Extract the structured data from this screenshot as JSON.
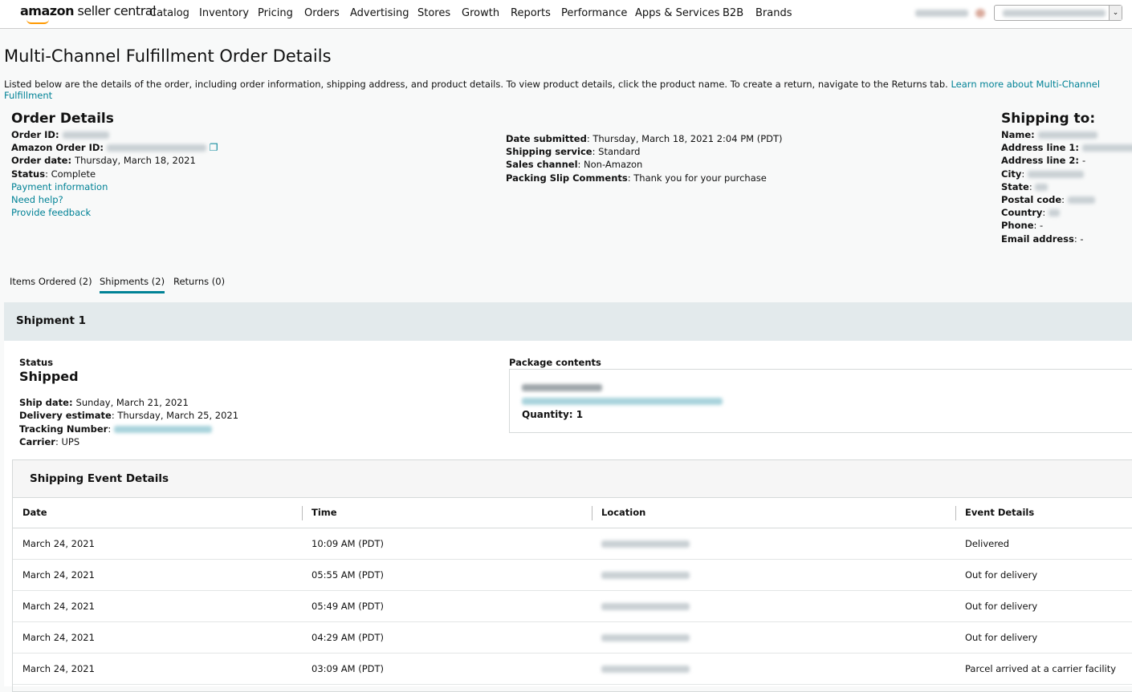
{
  "nav": {
    "logo_bold": "amazon",
    "logo_rest": " seller central",
    "items": [
      "Catalog",
      "Inventory",
      "Pricing",
      "Orders",
      "Advertising",
      "Stores",
      "Growth",
      "Reports",
      "Performance",
      "Apps & Services",
      "B2B",
      "Brands"
    ]
  },
  "page": {
    "title": "Multi-Channel Fulfillment Order Details",
    "description": "Listed below are the details of the order, including order information, shipping address, and product details. To view product details, click the product name. To create a return, navigate to the Returns tab. ",
    "learn_more": "Learn more about Multi-Channel Fulfillment"
  },
  "order": {
    "heading": "Order Details",
    "order_id_label": "Order ID",
    "amazon_order_id_label": "Amazon Order ID",
    "order_date_label": "Order date",
    "order_date": "Thursday, March 18, 2021",
    "status_label": "Status",
    "status": "Complete",
    "links": [
      "Payment information",
      "Need help?",
      "Provide feedback"
    ]
  },
  "middle": {
    "date_submitted_label": "Date submitted",
    "date_submitted": "Thursday, March 18, 2021 2:04 PM (PDT)",
    "shipping_service_label": "Shipping service",
    "shipping_service": "Standard",
    "sales_channel_label": "Sales channel",
    "sales_channel": "Non-Amazon",
    "packing_slip_label": "Packing Slip Comments",
    "packing_slip": "Thank you for your purchase"
  },
  "shipping_to": {
    "heading": "Shipping to:",
    "name_label": "Name",
    "address1_label": "Address line 1",
    "address2_label": "Address line 2",
    "address2": "-",
    "city_label": "City",
    "state_label": "State",
    "postal_label": "Postal code",
    "country_label": "Country",
    "phone_label": "Phone",
    "phone": "-",
    "email_label": "Email address",
    "email": "-"
  },
  "tabs": [
    "Items Ordered (2)",
    "Shipments (2)",
    "Returns (0)"
  ],
  "shipment": {
    "title": "Shipment 1",
    "status_label": "Status",
    "status": "Shipped",
    "ship_date_label": "Ship date",
    "ship_date": "Sunday, March 21, 2021",
    "delivery_label": "Delivery estimate",
    "delivery": "Thursday, March 25, 2021",
    "tracking_label": "Tracking Number",
    "carrier_label": "Carrier",
    "carrier": "UPS",
    "package_label": "Package contents",
    "quantity_label": "Quantity",
    "quantity": "1"
  },
  "events": {
    "title": "Shipping Event Details",
    "columns": [
      "Date",
      "Time",
      "Location",
      "Event Details"
    ],
    "rows": [
      {
        "date": "March 24, 2021",
        "time": "10:09 AM (PDT)",
        "event": "Delivered"
      },
      {
        "date": "March 24, 2021",
        "time": "05:55 AM (PDT)",
        "event": "Out for delivery"
      },
      {
        "date": "March 24, 2021",
        "time": "05:49 AM (PDT)",
        "event": "Out for delivery"
      },
      {
        "date": "March 24, 2021",
        "time": "04:29 AM (PDT)",
        "event": "Out for delivery"
      },
      {
        "date": "March 24, 2021",
        "time": "03:09 AM (PDT)",
        "event": "Parcel arrived at a carrier facility"
      }
    ]
  }
}
